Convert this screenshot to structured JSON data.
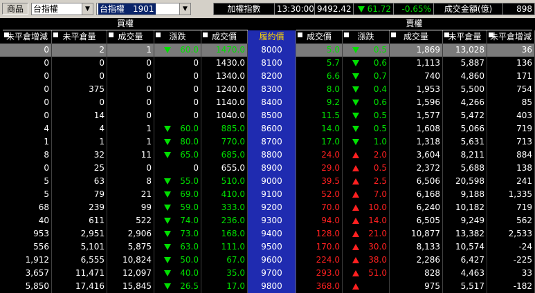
{
  "toolbar": {
    "product_label": "商品",
    "product_value": "台指權",
    "month_value": "台指權　1901",
    "ticker": {
      "name": "加權指數",
      "time": "13:30:00",
      "price": "9492.42",
      "change": "61.72",
      "change_pct": "-0.65%",
      "turnover_label": "成交金額(億)",
      "turnover": "898"
    }
  },
  "headers": {
    "call_group": "買權",
    "put_group": "賣權",
    "columns_call": [
      "未平倉增減",
      "未平倉量",
      "成交量",
      "漲跌",
      "成交價"
    ],
    "strike": "履約價",
    "columns_put": [
      "成交價",
      "漲跌",
      "成交量",
      "未平倉量",
      "未平倉增減"
    ]
  },
  "colors": {
    "up": "#ff2020",
    "down": "#00e000",
    "strike_bg": "#1f2bb0"
  },
  "rows": [
    {
      "c_oi_chg": "0",
      "c_oi": "2",
      "c_vol": "1",
      "c_dir": "down",
      "c_chg": "60.0",
      "c_price": "1470.0",
      "strike": "8000",
      "p_price": "5.0",
      "p_dir": "down",
      "p_chg": "0.5",
      "p_vol": "1,869",
      "p_oi": "13,028",
      "p_oi_chg": "36",
      "selected": true
    },
    {
      "c_oi_chg": "0",
      "c_oi": "0",
      "c_vol": "0",
      "c_dir": "",
      "c_chg": "0",
      "c_price": "1430.0",
      "strike": "8100",
      "p_price": "5.7",
      "p_dir": "down",
      "p_chg": "0.6",
      "p_vol": "1,113",
      "p_oi": "5,887",
      "p_oi_chg": "136"
    },
    {
      "c_oi_chg": "0",
      "c_oi": "0",
      "c_vol": "0",
      "c_dir": "",
      "c_chg": "0",
      "c_price": "1340.0",
      "strike": "8200",
      "p_price": "6.6",
      "p_dir": "down",
      "p_chg": "0.7",
      "p_vol": "740",
      "p_oi": "4,860",
      "p_oi_chg": "171"
    },
    {
      "c_oi_chg": "0",
      "c_oi": "375",
      "c_vol": "0",
      "c_dir": "",
      "c_chg": "0",
      "c_price": "1240.0",
      "strike": "8300",
      "p_price": "8.0",
      "p_dir": "down",
      "p_chg": "0.4",
      "p_vol": "1,953",
      "p_oi": "5,500",
      "p_oi_chg": "754"
    },
    {
      "c_oi_chg": "0",
      "c_oi": "0",
      "c_vol": "0",
      "c_dir": "",
      "c_chg": "0",
      "c_price": "1140.0",
      "strike": "8400",
      "p_price": "9.2",
      "p_dir": "down",
      "p_chg": "0.6",
      "p_vol": "1,596",
      "p_oi": "4,266",
      "p_oi_chg": "85"
    },
    {
      "c_oi_chg": "0",
      "c_oi": "14",
      "c_vol": "0",
      "c_dir": "",
      "c_chg": "0",
      "c_price": "1040.0",
      "strike": "8500",
      "p_price": "11.5",
      "p_dir": "down",
      "p_chg": "0.5",
      "p_vol": "1,577",
      "p_oi": "5,472",
      "p_oi_chg": "403"
    },
    {
      "c_oi_chg": "4",
      "c_oi": "4",
      "c_vol": "1",
      "c_dir": "down",
      "c_chg": "60.0",
      "c_price": "885.0",
      "strike": "8600",
      "p_price": "14.0",
      "p_dir": "down",
      "p_chg": "0.5",
      "p_vol": "1,608",
      "p_oi": "5,066",
      "p_oi_chg": "719"
    },
    {
      "c_oi_chg": "1",
      "c_oi": "1",
      "c_vol": "1",
      "c_dir": "down",
      "c_chg": "80.0",
      "c_price": "770.0",
      "strike": "8700",
      "p_price": "17.0",
      "p_dir": "down",
      "p_chg": "1.0",
      "p_vol": "1,318",
      "p_oi": "5,631",
      "p_oi_chg": "713"
    },
    {
      "c_oi_chg": "8",
      "c_oi": "32",
      "c_vol": "11",
      "c_dir": "down",
      "c_chg": "65.0",
      "c_price": "685.0",
      "strike": "8800",
      "p_price": "24.0",
      "p_dir": "up",
      "p_chg": "2.0",
      "p_vol": "3,604",
      "p_oi": "8,211",
      "p_oi_chg": "884"
    },
    {
      "c_oi_chg": "0",
      "c_oi": "25",
      "c_vol": "0",
      "c_dir": "",
      "c_chg": "0",
      "c_price": "655.0",
      "strike": "8900",
      "p_price": "29.0",
      "p_dir": "up",
      "p_chg": "0.5",
      "p_vol": "2,372",
      "p_oi": "5,688",
      "p_oi_chg": "138"
    },
    {
      "c_oi_chg": "5",
      "c_oi": "63",
      "c_vol": "8",
      "c_dir": "down",
      "c_chg": "55.0",
      "c_price": "510.0",
      "strike": "9000",
      "p_price": "39.5",
      "p_dir": "up",
      "p_chg": "2.5",
      "p_vol": "6,506",
      "p_oi": "20,598",
      "p_oi_chg": "241"
    },
    {
      "c_oi_chg": "5",
      "c_oi": "79",
      "c_vol": "21",
      "c_dir": "down",
      "c_chg": "69.0",
      "c_price": "410.0",
      "strike": "9100",
      "p_price": "52.0",
      "p_dir": "up",
      "p_chg": "7.0",
      "p_vol": "6,168",
      "p_oi": "9,188",
      "p_oi_chg": "1,335"
    },
    {
      "c_oi_chg": "68",
      "c_oi": "239",
      "c_vol": "99",
      "c_dir": "down",
      "c_chg": "59.0",
      "c_price": "333.0",
      "strike": "9200",
      "p_price": "70.0",
      "p_dir": "up",
      "p_chg": "10.0",
      "p_vol": "6,240",
      "p_oi": "10,182",
      "p_oi_chg": "719"
    },
    {
      "c_oi_chg": "40",
      "c_oi": "611",
      "c_vol": "522",
      "c_dir": "down",
      "c_chg": "74.0",
      "c_price": "236.0",
      "strike": "9300",
      "p_price": "94.0",
      "p_dir": "up",
      "p_chg": "14.0",
      "p_vol": "6,505",
      "p_oi": "9,249",
      "p_oi_chg": "562"
    },
    {
      "c_oi_chg": "953",
      "c_oi": "2,951",
      "c_vol": "2,906",
      "c_dir": "down",
      "c_chg": "73.0",
      "c_price": "168.0",
      "strike": "9400",
      "p_price": "128.0",
      "p_dir": "up",
      "p_chg": "21.0",
      "p_vol": "10,877",
      "p_oi": "13,382",
      "p_oi_chg": "2,533"
    },
    {
      "c_oi_chg": "556",
      "c_oi": "5,101",
      "c_vol": "5,875",
      "c_dir": "down",
      "c_chg": "63.0",
      "c_price": "111.0",
      "strike": "9500",
      "p_price": "170.0",
      "p_dir": "up",
      "p_chg": "30.0",
      "p_vol": "8,133",
      "p_oi": "10,574",
      "p_oi_chg": "-24"
    },
    {
      "c_oi_chg": "1,912",
      "c_oi": "6,555",
      "c_vol": "10,824",
      "c_dir": "down",
      "c_chg": "50.0",
      "c_price": "67.0",
      "strike": "9600",
      "p_price": "224.0",
      "p_dir": "up",
      "p_chg": "38.0",
      "p_vol": "2,286",
      "p_oi": "6,427",
      "p_oi_chg": "-225"
    },
    {
      "c_oi_chg": "3,657",
      "c_oi": "11,471",
      "c_vol": "12,097",
      "c_dir": "down",
      "c_chg": "40.0",
      "c_price": "35.0",
      "strike": "9700",
      "p_price": "293.0",
      "p_dir": "up",
      "p_chg": "51.0",
      "p_vol": "828",
      "p_oi": "4,463",
      "p_oi_chg": "33"
    },
    {
      "c_oi_chg": "5,850",
      "c_oi": "17,416",
      "c_vol": "15,845",
      "c_dir": "down",
      "c_chg": "26.5",
      "c_price": "17.0",
      "strike": "9800",
      "p_price": "368.0",
      "p_dir": "up",
      "p_chg": "",
      "p_vol": "975",
      "p_oi": "5,517",
      "p_oi_chg": "-182"
    }
  ]
}
